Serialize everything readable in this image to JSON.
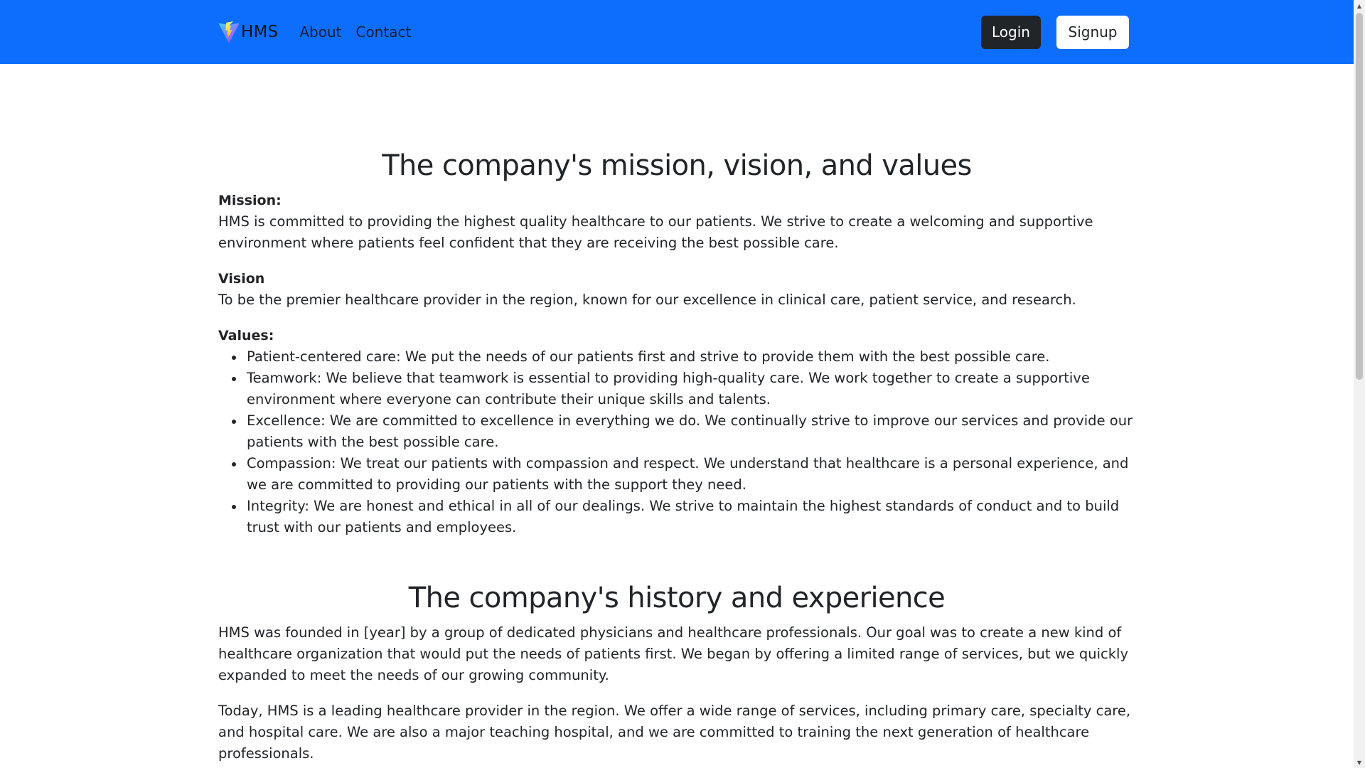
{
  "navbar": {
    "brand": "HMS",
    "links": [
      "About",
      "Contact"
    ],
    "login_label": "Login",
    "signup_label": "Signup"
  },
  "mvv": {
    "title": "The company's mission, vision, and values",
    "mission_label": "Mission:",
    "mission_text": "HMS is committed to providing the highest quality healthcare to our patients. We strive to create a welcoming and supportive environment where patients feel confident that they are receiving the best possible care.",
    "vision_label": "Vision",
    "vision_text": "To be the premier healthcare provider in the region, known for our excellence in clinical care, patient service, and research.",
    "values_label": "Values:",
    "values": [
      "Patient-centered care: We put the needs of our patients first and strive to provide them with the best possible care.",
      "Teamwork: We believe that teamwork is essential to providing high-quality care. We work together to create a supportive environment where everyone can contribute their unique skills and talents.",
      "Excellence: We are committed to excellence in everything we do. We continually strive to improve our services and provide our patients with the best possible care.",
      "Compassion: We treat our patients with compassion and respect. We understand that healthcare is a personal experience, and we are committed to providing our patients with the support they need.",
      "Integrity: We are honest and ethical in all of our dealings. We strive to maintain the highest standards of conduct and to build trust with our patients and employees."
    ]
  },
  "history": {
    "title": "The company's history and experience",
    "paragraphs": [
      "HMS was founded in [year] by a group of dedicated physicians and healthcare professionals. Our goal was to create a new kind of healthcare organization that would put the needs of patients first. We began by offering a limited range of services, but we quickly expanded to meet the needs of our growing community.",
      "Today, HMS is a leading healthcare provider in the region. We offer a wide range of services, including primary care, specialty care, and hospital care. We are also a major teaching hospital, and we are committed to training the next generation of healthcare professionals."
    ]
  },
  "colors": {
    "navbar_bg": "#0d6efd",
    "text": "#212529",
    "login_bg": "#212529",
    "signup_bg": "#ffffff"
  },
  "icons": {
    "brand_logo": "lightning-bolt-logo-icon"
  }
}
